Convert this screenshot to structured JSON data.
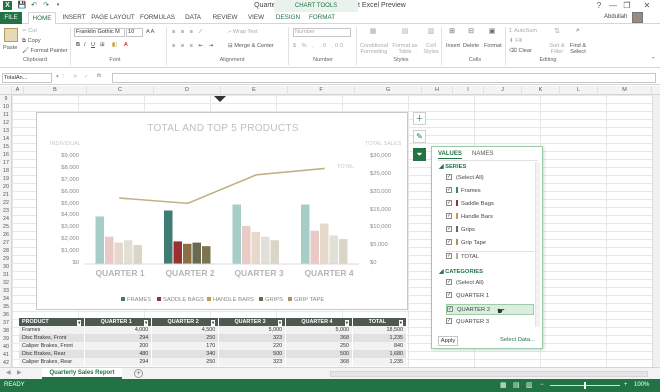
{
  "window": {
    "title": "Quarterly sales report1 - Microsoft Excel Preview",
    "chart_tools": "CHART TOOLS",
    "user": "Abdullah",
    "controls": [
      "?",
      "—",
      "❐",
      "✕"
    ]
  },
  "quick_access": [
    "💾",
    "↶",
    "↷"
  ],
  "tabs": [
    "FILE",
    "HOME",
    "INSERT",
    "PAGE LAYOUT",
    "FORMULAS",
    "DATA",
    "REVIEW",
    "VIEW",
    "DESIGN",
    "FORMAT"
  ],
  "ribbon": {
    "paste": "Paste",
    "cut": "Cut",
    "copy": "Copy",
    "format_painter": "Format Painter",
    "clipboard": "Clipboard",
    "font_name": "Franklin Gothic M",
    "font_size": "10",
    "font": "Font",
    "wrap_text": "Wrap Text",
    "merge_center": "Merge & Center",
    "alignment": "Alignment",
    "number_format": "Number",
    "number": "Number",
    "conditional": "Conditional",
    "formatting": "Formatting",
    "format_as": "Format as",
    "table": "Table",
    "cell": "Cell",
    "styles_btn": "Styles",
    "styles": "Styles",
    "insert": "Insert",
    "delete": "Delete",
    "format": "Format",
    "cells": "Cells",
    "autosum": "AutoSum",
    "fill": "Fill",
    "clear": "Clear",
    "sort_filter": "Sort &",
    "filter": "Filter",
    "find_select": "Find &",
    "select": "Select",
    "editing": "Editing"
  },
  "formula_bar": {
    "name_box": "TotalAn...",
    "fx": "fx",
    "value": ""
  },
  "columns": [
    "A",
    "B",
    "C",
    "D",
    "E",
    "F",
    "G",
    "H",
    "I",
    "J",
    "K",
    "L",
    "M"
  ],
  "rows": [
    "9",
    "10",
    "11",
    "12",
    "13",
    "14",
    "15",
    "16",
    "17",
    "18",
    "19",
    "20",
    "21",
    "22",
    "23",
    "24",
    "25",
    "26",
    "27",
    "28",
    "29",
    "30",
    "31",
    "32",
    "33",
    "34",
    "35",
    "36",
    "37",
    "38",
    "39",
    "40",
    "41",
    "42"
  ],
  "colors": {
    "accent": "#217346",
    "frames": "#a7cdc9",
    "saddle_bags": "#e9cac6",
    "handle_bars": "#e6d9cc",
    "grips": "#e2dfd6",
    "grip_tape": "#d9d6c7",
    "total": "#c2b08a"
  },
  "chart_data": {
    "type": "bar",
    "title": "TOTAL AND TOP 5 PRODUCTS",
    "left_axis_label": "INDIVIDUAL",
    "right_axis_label": "TOTAL SALES",
    "categories": [
      "QUARTER 1",
      "QUARTER 2",
      "QUARTER 3",
      "QUARTER 4"
    ],
    "series": [
      {
        "name": "FRAMES",
        "color": "#a7cdc9",
        "values": [
          4000,
          4500,
          5000,
          5000
        ]
      },
      {
        "name": "SADDLE BAGS",
        "color": "#e9cac6",
        "values": [
          2300,
          1900,
          3200,
          2800
        ]
      },
      {
        "name": "HANDLE BARS",
        "color": "#e6d9cc",
        "values": [
          1800,
          1700,
          2700,
          3400
        ]
      },
      {
        "name": "GRIPS",
        "color": "#e2dfd6",
        "values": [
          2000,
          1800,
          2300,
          2400
        ]
      },
      {
        "name": "GRIP TAPE",
        "color": "#d9d6c7",
        "values": [
          1600,
          1500,
          2000,
          2100
        ]
      }
    ],
    "highlighted_category": "QUARTER 2",
    "highlight_colors": [
      "#3f7c74",
      "#9b3030",
      "#8a6e44",
      "#6c6a4e",
      "#7d7450"
    ],
    "line": {
      "name": "TOTAL",
      "color": "#c2b08a",
      "values": [
        18500,
        17000,
        25000,
        26800
      ]
    },
    "left_ylim": [
      0,
      9000
    ],
    "left_ticks": [
      "$9,000",
      "$8,000",
      "$7,000",
      "$6,000",
      "$5,000",
      "$4,000",
      "$3,000",
      "$2,000",
      "$1,000",
      "$0"
    ],
    "right_ylim": [
      0,
      30000
    ],
    "right_ticks": [
      "$30,000",
      "$25,000",
      "$20,000",
      "$15,000",
      "$10,000",
      "$5,000",
      "$0"
    ],
    "legend_position": "bottom"
  },
  "filter_pane": {
    "tab_values": "VALUES",
    "tab_names": "NAMES",
    "series_header": "SERIES",
    "series": [
      {
        "label": "(Select All)",
        "color": ""
      },
      {
        "label": "Frames",
        "color": "#3f7c74"
      },
      {
        "label": "Saddle Bags",
        "color": "#9b3030"
      },
      {
        "label": "Handle Bars",
        "color": "#c59a52"
      },
      {
        "label": "Grips",
        "color": "#6c6a4e"
      },
      {
        "label": "Grip Tape",
        "color": "#a69561"
      },
      {
        "label": "TOTAL",
        "color": "#c2b08a"
      }
    ],
    "categories_header": "CATEGORIES",
    "categories": [
      "(Select All)",
      "QUARTER 1",
      "QUARTER 2",
      "QUARTER 3"
    ],
    "hovered_category": "QUARTER 2",
    "apply": "Apply",
    "select_data": "Select Data..."
  },
  "table": {
    "headers": [
      "PRODUCT",
      "QUARTER 1",
      "QUARTER 2",
      "QUARTER 3",
      "QUARTER 4",
      "TOTAL"
    ],
    "rows": [
      [
        "Frames",
        "4,000",
        "4,500",
        "5,000",
        "5,000",
        "18,500"
      ],
      [
        "Disc Brakes, Front",
        "294",
        "250",
        "323",
        "368",
        "1,235"
      ],
      [
        "Caliper Brakes, Front",
        "200",
        "170",
        "220",
        "250",
        "840"
      ],
      [
        "Disc Brakes, Rear",
        "480",
        "340",
        "500",
        "500",
        "1,680"
      ],
      [
        "Caliper Brakes, Rear",
        "294",
        "250",
        "323",
        "368",
        "1,235"
      ]
    ]
  },
  "sheet_tab": "Quarterly Sales Report",
  "status": {
    "ready": "READY",
    "zoom": "100%"
  }
}
